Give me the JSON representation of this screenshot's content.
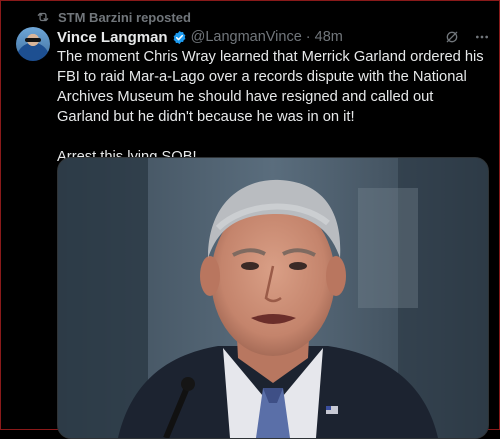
{
  "repost": {
    "label": "STM Barzini reposted",
    "icon": "repost-icon"
  },
  "post": {
    "author_name": "Vince Langman",
    "handle": "@LangmanVince",
    "separator": "·",
    "time": "48m",
    "verified_icon": "verified-badge-icon",
    "verified_color": "#1d9bf0",
    "text_paragraph_1": "The moment Chris Wray learned that Merrick Garland ordered his FBI to raid Mar-a-Lago over a records dispute with the National Archives Museum he should have resigned and called out Garland but he didn't because he was in on it!",
    "text_paragraph_2": "Arrest this lying SOB!",
    "media_icon": "photo-image"
  },
  "colors": {
    "background": "#000000",
    "text_primary": "#e7e9ea",
    "text_secondary": "#71767b",
    "frame_border": "#8a1a1a"
  }
}
